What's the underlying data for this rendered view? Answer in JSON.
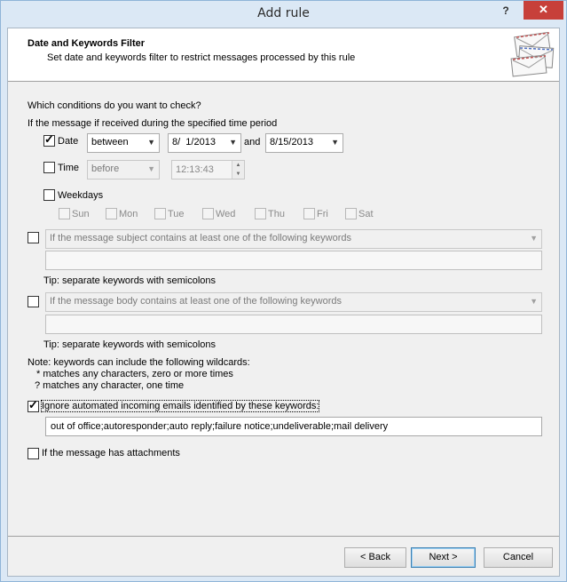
{
  "window": {
    "title": "Add rule",
    "help_glyph": "?",
    "close_glyph": "✕"
  },
  "header": {
    "title": "Date and Keywords Filter",
    "subtitle": "Set date and keywords filter to restrict messages processed by this rule",
    "icon": "envelopes-icon"
  },
  "conditions": {
    "question": "Which conditions do you want to check?",
    "period_label": "If the message if received during the specified time period",
    "date": {
      "label": "Date",
      "checked": true,
      "mode": "between",
      "from": "8/  1/2013",
      "and_label": "and",
      "to": "8/15/2013"
    },
    "time": {
      "label": "Time",
      "checked": false,
      "mode": "before",
      "value": "12:13:43"
    },
    "weekdays": {
      "label": "Weekdays",
      "checked": false,
      "days": [
        "Sun",
        "Mon",
        "Tue",
        "Wed",
        "Thu",
        "Fri",
        "Sat"
      ]
    },
    "subject": {
      "checked": false,
      "combo": "If the message subject contains at least one of the following keywords",
      "value": "",
      "tip": "Tip: separate keywords with semicolons"
    },
    "body": {
      "checked": false,
      "combo": "If the message body contains at least one of the following keywords",
      "value": "",
      "tip": "Tip: separate keywords with semicolons"
    },
    "note": {
      "line1": "Note: keywords can include the following wildcards:",
      "line2": "* matches any characters, zero or more times",
      "line3": "? matches any character, one time"
    },
    "ignore": {
      "checked": true,
      "label": "Ignore automated incoming emails identified by these keywords:",
      "value": "out of office;autoresponder;auto reply;failure notice;undeliverable;mail delivery"
    },
    "attachments": {
      "checked": false,
      "label": "If the message has attachments"
    }
  },
  "buttons": {
    "back": "< Back",
    "next": "Next >",
    "cancel": "Cancel"
  }
}
